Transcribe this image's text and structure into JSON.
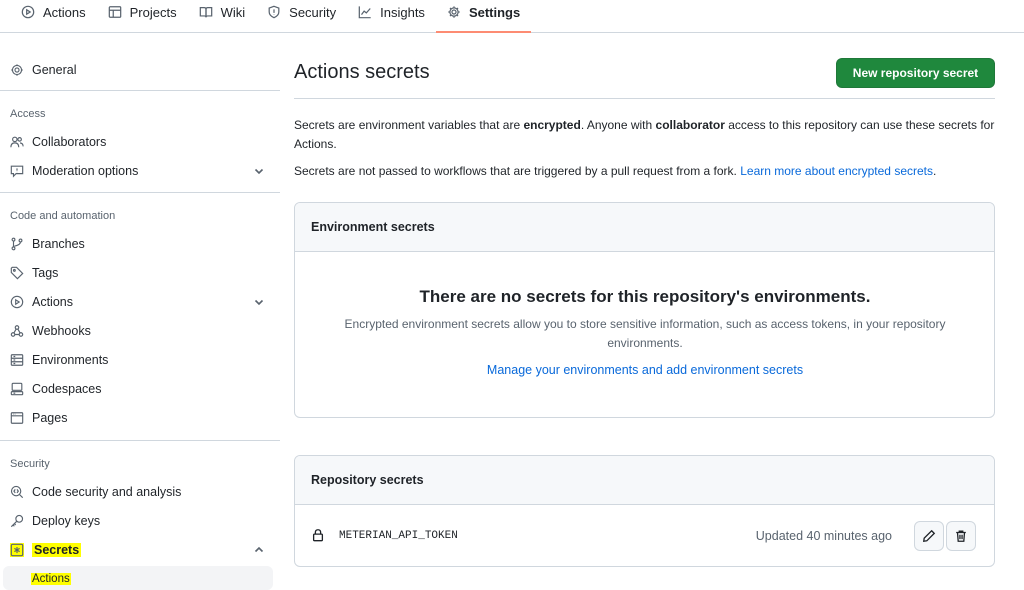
{
  "topnav": {
    "tabs": [
      {
        "label": "Actions",
        "icon": "play-circle-icon"
      },
      {
        "label": "Projects",
        "icon": "table-icon"
      },
      {
        "label": "Wiki",
        "icon": "book-icon"
      },
      {
        "label": "Security",
        "icon": "shield-icon"
      },
      {
        "label": "Insights",
        "icon": "graph-icon"
      },
      {
        "label": "Settings",
        "icon": "gear-icon",
        "active": true
      }
    ]
  },
  "sidebar": {
    "general": "General",
    "access_heading": "Access",
    "collaborators": "Collaborators",
    "moderation": "Moderation options",
    "code_heading": "Code and automation",
    "branches": "Branches",
    "tags": "Tags",
    "actions": "Actions",
    "webhooks": "Webhooks",
    "environments": "Environments",
    "codespaces": "Codespaces",
    "pages": "Pages",
    "security_heading": "Security",
    "code_security": "Code security and analysis",
    "deploy_keys": "Deploy keys",
    "secrets": "Secrets",
    "secrets_sub": "Actions"
  },
  "main": {
    "title": "Actions secrets",
    "new_button": "New repository secret",
    "intro": {
      "p1_a": "Secrets are environment variables that are ",
      "p1_b": "encrypted",
      "p1_c": ". Anyone with ",
      "p1_d": "collaborator",
      "p1_e": " access to this repository can use these secrets for Actions.",
      "p2_a": "Secrets are not passed to workflows that are triggered by a pull request from a fork. ",
      "p2_link": "Learn more about encrypted secrets",
      "p2_end": "."
    },
    "env_box": {
      "header": "Environment secrets",
      "empty_title": "There are no secrets for this repository's environments.",
      "empty_desc": "Encrypted environment secrets allow you to store sensitive information, such as access tokens, in your repository environments.",
      "manage_link": "Manage your environments and add environment secrets"
    },
    "repo_box": {
      "header": "Repository secrets",
      "secrets": [
        {
          "name": "METERIAN_API_TOKEN",
          "updated": "Updated 40 minutes ago"
        }
      ]
    }
  },
  "colors": {
    "primary_button": "#1f883d",
    "link": "#0969da",
    "active_tab_underline": "#fd8c73",
    "highlight": "#ffff00"
  }
}
